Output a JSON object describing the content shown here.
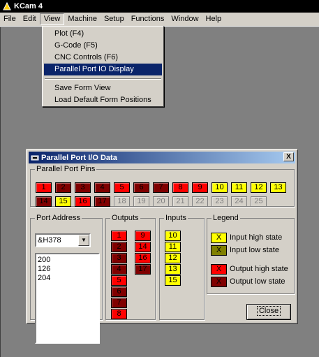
{
  "app": {
    "title": "KCam 4"
  },
  "menu": [
    "File",
    "Edit",
    "View",
    "Machine",
    "Setup",
    "Functions",
    "Window",
    "Help"
  ],
  "view_menu": {
    "items": [
      "Plot (F4)",
      "G-Code (F5)",
      "CNC Controls (F6)",
      "Parallel Port IO Display"
    ],
    "items2": [
      "Save Form View",
      "Load Default Form Positions"
    ],
    "selected": "Parallel Port IO Display"
  },
  "dialog": {
    "title": "Parallel Port I/O Data",
    "close_glyph": "X",
    "pins_group": "Parallel Port Pins",
    "pins": [
      {
        "n": "1",
        "s": "hi"
      },
      {
        "n": "2",
        "s": "lo"
      },
      {
        "n": "3",
        "s": "lo"
      },
      {
        "n": "4",
        "s": "lo"
      },
      {
        "n": "5",
        "s": "hi"
      },
      {
        "n": "6",
        "s": "lo"
      },
      {
        "n": "7",
        "s": "lo"
      },
      {
        "n": "8",
        "s": "hi"
      },
      {
        "n": "9",
        "s": "hi"
      },
      {
        "n": "10",
        "s": "in"
      },
      {
        "n": "11",
        "s": "in"
      },
      {
        "n": "12",
        "s": "in"
      },
      {
        "n": "13",
        "s": "in"
      },
      {
        "n": "14",
        "s": "lo"
      },
      {
        "n": "15",
        "s": "in"
      },
      {
        "n": "16",
        "s": "hi"
      },
      {
        "n": "17",
        "s": "lo"
      },
      {
        "n": "18",
        "s": "dis"
      },
      {
        "n": "19",
        "s": "dis"
      },
      {
        "n": "20",
        "s": "dis"
      },
      {
        "n": "21",
        "s": "dis"
      },
      {
        "n": "22",
        "s": "dis"
      },
      {
        "n": "23",
        "s": "dis"
      },
      {
        "n": "24",
        "s": "dis"
      },
      {
        "n": "25",
        "s": "dis"
      }
    ],
    "port_group": "Port Address",
    "port_value": "&H378",
    "memo_lines": [
      "200",
      "126",
      "204"
    ],
    "outputs_group": "Outputs",
    "outputs_col1": [
      {
        "n": "1",
        "s": "hi"
      },
      {
        "n": "2",
        "s": "lo"
      },
      {
        "n": "3",
        "s": "lo"
      },
      {
        "n": "4",
        "s": "lo"
      },
      {
        "n": "5",
        "s": "hi"
      },
      {
        "n": "6",
        "s": "lo"
      },
      {
        "n": "7",
        "s": "lo"
      },
      {
        "n": "8",
        "s": "hi"
      }
    ],
    "outputs_col2": [
      {
        "n": "9",
        "s": "hi"
      },
      {
        "n": "14",
        "s": "hi"
      },
      {
        "n": "16",
        "s": "hi"
      },
      {
        "n": "17",
        "s": "lo"
      }
    ],
    "inputs_group": "Inputs",
    "inputs": [
      "10",
      "11",
      "12",
      "13",
      "15"
    ],
    "legend_group": "Legend",
    "legend": [
      {
        "mark": "X",
        "s": "in",
        "label": "Input high state"
      },
      {
        "mark": "X",
        "s": "inlo",
        "label": "Input low state"
      },
      {
        "mark": "X",
        "s": "hi",
        "label": "Output high state"
      },
      {
        "mark": "X",
        "s": "lo",
        "label": "Output low state"
      }
    ],
    "close_button": "Close"
  },
  "colors": {
    "output_high": "#ff0000",
    "output_low": "#800000",
    "input_high": "#ffff00",
    "input_low": "#808000",
    "title_gradient_start": "#0a246a"
  }
}
